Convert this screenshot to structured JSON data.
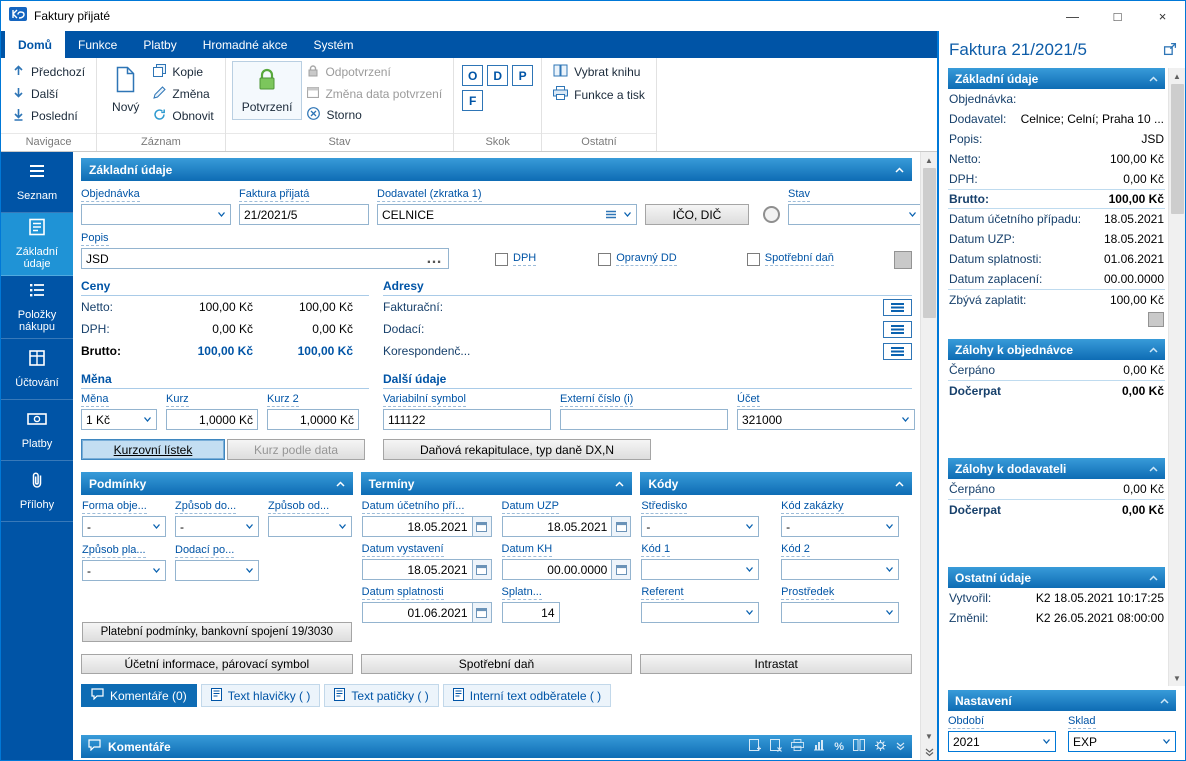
{
  "window": {
    "title": "Faktury přijaté"
  },
  "icons": {
    "minimize": "—",
    "maximize": "□",
    "close": "×",
    "ellipsis": "…",
    "scroll_up": "▲",
    "scroll_down": "▼",
    "percent": "%"
  },
  "ribbon": {
    "tabs": [
      {
        "label": "Domů"
      },
      {
        "label": "Funkce"
      },
      {
        "label": "Platby"
      },
      {
        "label": "Hromadné akce"
      },
      {
        "label": "Systém"
      }
    ],
    "navigace": {
      "label": "Navigace",
      "prev": "Předchozí",
      "next": "Další",
      "last": "Poslední"
    },
    "zaznam": {
      "label": "Záznam",
      "novy": "Nový",
      "kopie": "Kopie",
      "zmena": "Změna",
      "obnovit": "Obnovit"
    },
    "stav": {
      "label": "Stav",
      "potvrzeni": "Potvrzení",
      "odpotvrzeni": "Odpotvrzení",
      "zmena_data": "Změna data potvrzení",
      "storno": "Storno"
    },
    "skok": {
      "label": "Skok",
      "o": "O",
      "d": "D",
      "p": "P",
      "f": "F"
    },
    "ostatni": {
      "label": "Ostatní",
      "vybrat_knihu": "Vybrat knihu",
      "funkce_a_tisk": "Funkce a tisk"
    }
  },
  "sidebar": {
    "items": [
      {
        "label": "Seznam"
      },
      {
        "label": "Základní údaje"
      },
      {
        "label": "Položky nákupu"
      },
      {
        "label": "Účtování"
      },
      {
        "label": "Platby"
      },
      {
        "label": "Přílohy"
      }
    ]
  },
  "form": {
    "header": "Základní údaje",
    "fields": {
      "objednavka": {
        "label": "Objednávka",
        "value": ""
      },
      "faktura": {
        "label": "Faktura přijatá",
        "value": "21/2021/5"
      },
      "dodavatel": {
        "label": "Dodavatel (zkratka 1)",
        "value": "CELNICE"
      },
      "ico_dic_button": "IČO, DIČ",
      "stav": {
        "label": "Stav",
        "value": ""
      },
      "popis": {
        "label": "Popis",
        "value": "JSD"
      },
      "dph_checkbox": "DPH",
      "opravny_checkbox": "Opravný DD",
      "spotrebni_checkbox": "Spotřební daň"
    },
    "ceny": {
      "header": "Ceny",
      "netto": {
        "label": "Netto:",
        "v1": "100,00 Kč",
        "v2": "100,00 Kč"
      },
      "dph": {
        "label": "DPH:",
        "v1": "0,00 Kč",
        "v2": "0,00 Kč"
      },
      "brutto": {
        "label": "Brutto:",
        "v1": "100,00 Kč",
        "v2": "100,00 Kč"
      }
    },
    "adresy": {
      "header": "Adresy",
      "rows": [
        {
          "label": "Fakturační:"
        },
        {
          "label": "Dodací:"
        },
        {
          "label": "Korespondenč..."
        }
      ]
    },
    "mena": {
      "header": "Měna",
      "mena": {
        "label": "Měna",
        "value": "1 Kč"
      },
      "kurz": {
        "label": "Kurz",
        "value": "1,0000 Kč"
      },
      "kurz2": {
        "label": "Kurz 2",
        "value": "1,0000 Kč"
      },
      "kurzovni_listek": "Kurzovní lístek",
      "kurz_podle_data": "Kurz podle data"
    },
    "dalsi_udaje": {
      "header": "Další údaje",
      "variabilni_symbol": {
        "label": "Variabilní symbol",
        "value": "111122"
      },
      "externi_cislo": {
        "label": "Externí číslo (i)",
        "value": ""
      },
      "ucet": {
        "label": "Účet",
        "value": "321000"
      },
      "danova_rekapitulace": "Daňová rekapitulace, typ daně DX,N"
    },
    "podminky": {
      "header": "Podmínky",
      "fields": [
        {
          "label": "Forma obje...",
          "value": "-"
        },
        {
          "label": "Způsob do...",
          "value": "-"
        },
        {
          "label": "Způsob od...",
          "value": ""
        },
        {
          "label": "Způsob pla...",
          "value": "-"
        },
        {
          "label": "Dodací po...",
          "value": ""
        }
      ],
      "button": "Platební podmínky, bankovní spojení 19/3030"
    },
    "terminy": {
      "header": "Termíny",
      "fields": [
        {
          "label": "Datum účetního pří...",
          "value": "18.05.2021"
        },
        {
          "label": "Datum UZP",
          "value": "18.05.2021"
        },
        {
          "label": "Datum vystavení",
          "value": "18.05.2021"
        },
        {
          "label": "Datum KH",
          "value": "00.00.0000"
        },
        {
          "label": "Datum splatnosti",
          "value": "01.06.2021"
        },
        {
          "label": "Splatn...",
          "value": "14"
        }
      ]
    },
    "kody": {
      "header": "Kódy",
      "fields": [
        {
          "label": "Středisko",
          "value": "-"
        },
        {
          "label": "Kód zakázky",
          "value": "-"
        },
        {
          "label": "Kód 1",
          "value": ""
        },
        {
          "label": "Kód 2",
          "value": ""
        },
        {
          "label": "Referent",
          "value": ""
        },
        {
          "label": "Prostředek",
          "value": ""
        }
      ]
    },
    "bottom_buttons": [
      {
        "label": "Účetní informace, párovací symbol"
      },
      {
        "label": "Spotřební daň"
      },
      {
        "label": "Intrastat"
      }
    ],
    "bottom_tabs": [
      {
        "label": "Komentáře (0)"
      },
      {
        "label": "Text hlavičky ( )"
      },
      {
        "label": "Text patičky ( )"
      },
      {
        "label": "Interní text odběratele ( )"
      }
    ],
    "komentare_header": "Komentáře"
  },
  "preview": {
    "title": "Faktura 21/2021/5",
    "zakladni": {
      "header": "Základní údaje",
      "rows": [
        {
          "label": "Objednávka:",
          "value": ""
        },
        {
          "label": "Dodavatel:",
          "value": "Celnice; Celní; Praha 10 ..."
        },
        {
          "label": "Popis:",
          "value": "JSD"
        },
        {
          "label": "Netto:",
          "value": "100,00 Kč"
        },
        {
          "label": "DPH:",
          "value": "0,00 Kč"
        },
        {
          "label": "Brutto:",
          "value": "100,00 Kč"
        },
        {
          "label": "Datum účetního případu:",
          "value": "18.05.2021"
        },
        {
          "label": "Datum UZP:",
          "value": "18.05.2021"
        },
        {
          "label": "Datum splatnosti:",
          "value": "01.06.2021"
        },
        {
          "label": "Datum zaplacení:",
          "value": "00.00.0000"
        },
        {
          "label": "Zbývá zaplatit:",
          "value": "100,00 Kč"
        }
      ]
    },
    "zalohy_objednavka": {
      "header": "Zálohy k objednávce",
      "rows": [
        {
          "label": "Čerpáno",
          "value": "0,00 Kč"
        },
        {
          "label": "Dočerpat",
          "value": "0,00 Kč"
        }
      ]
    },
    "zalohy_dodavatel": {
      "header": "Zálohy k dodavateli",
      "rows": [
        {
          "label": "Čerpáno",
          "value": "0,00 Kč"
        },
        {
          "label": "Dočerpat",
          "value": "0,00 Kč"
        }
      ]
    },
    "ostatni": {
      "header": "Ostatní údaje",
      "rows": [
        {
          "label": "Vytvořil:",
          "value": "K2 18.05.2021 10:17:25"
        },
        {
          "label": "Změnil:",
          "value": "K2 26.05.2021 08:00:00"
        }
      ]
    },
    "nastaveni": {
      "header": "Nastavení",
      "obdobi": {
        "label": "Období",
        "value": "2021"
      },
      "sklad": {
        "label": "Sklad",
        "value": "EXP"
      }
    }
  }
}
